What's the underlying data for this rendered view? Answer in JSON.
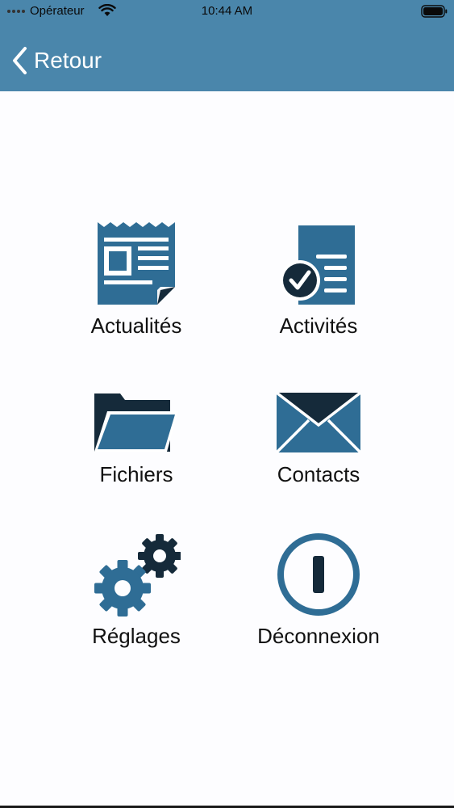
{
  "status_bar": {
    "carrier": "Opérateur",
    "time": "10:44 AM"
  },
  "nav": {
    "back_label": "Retour"
  },
  "colors": {
    "header": "#4a86ab",
    "icon_primary": "#2f6d95",
    "icon_dark": "#152a3a"
  },
  "menu": {
    "news": {
      "label": "Actualités",
      "icon": "newspaper-icon"
    },
    "activities": {
      "label": "Activités",
      "icon": "checklist-document-icon"
    },
    "files": {
      "label": "Fichiers",
      "icon": "folder-icon"
    },
    "contacts": {
      "label": "Contacts",
      "icon": "envelope-icon"
    },
    "settings": {
      "label": "Réglages",
      "icon": "gears-icon"
    },
    "logout": {
      "label": "Déconnexion",
      "icon": "power-icon"
    }
  }
}
